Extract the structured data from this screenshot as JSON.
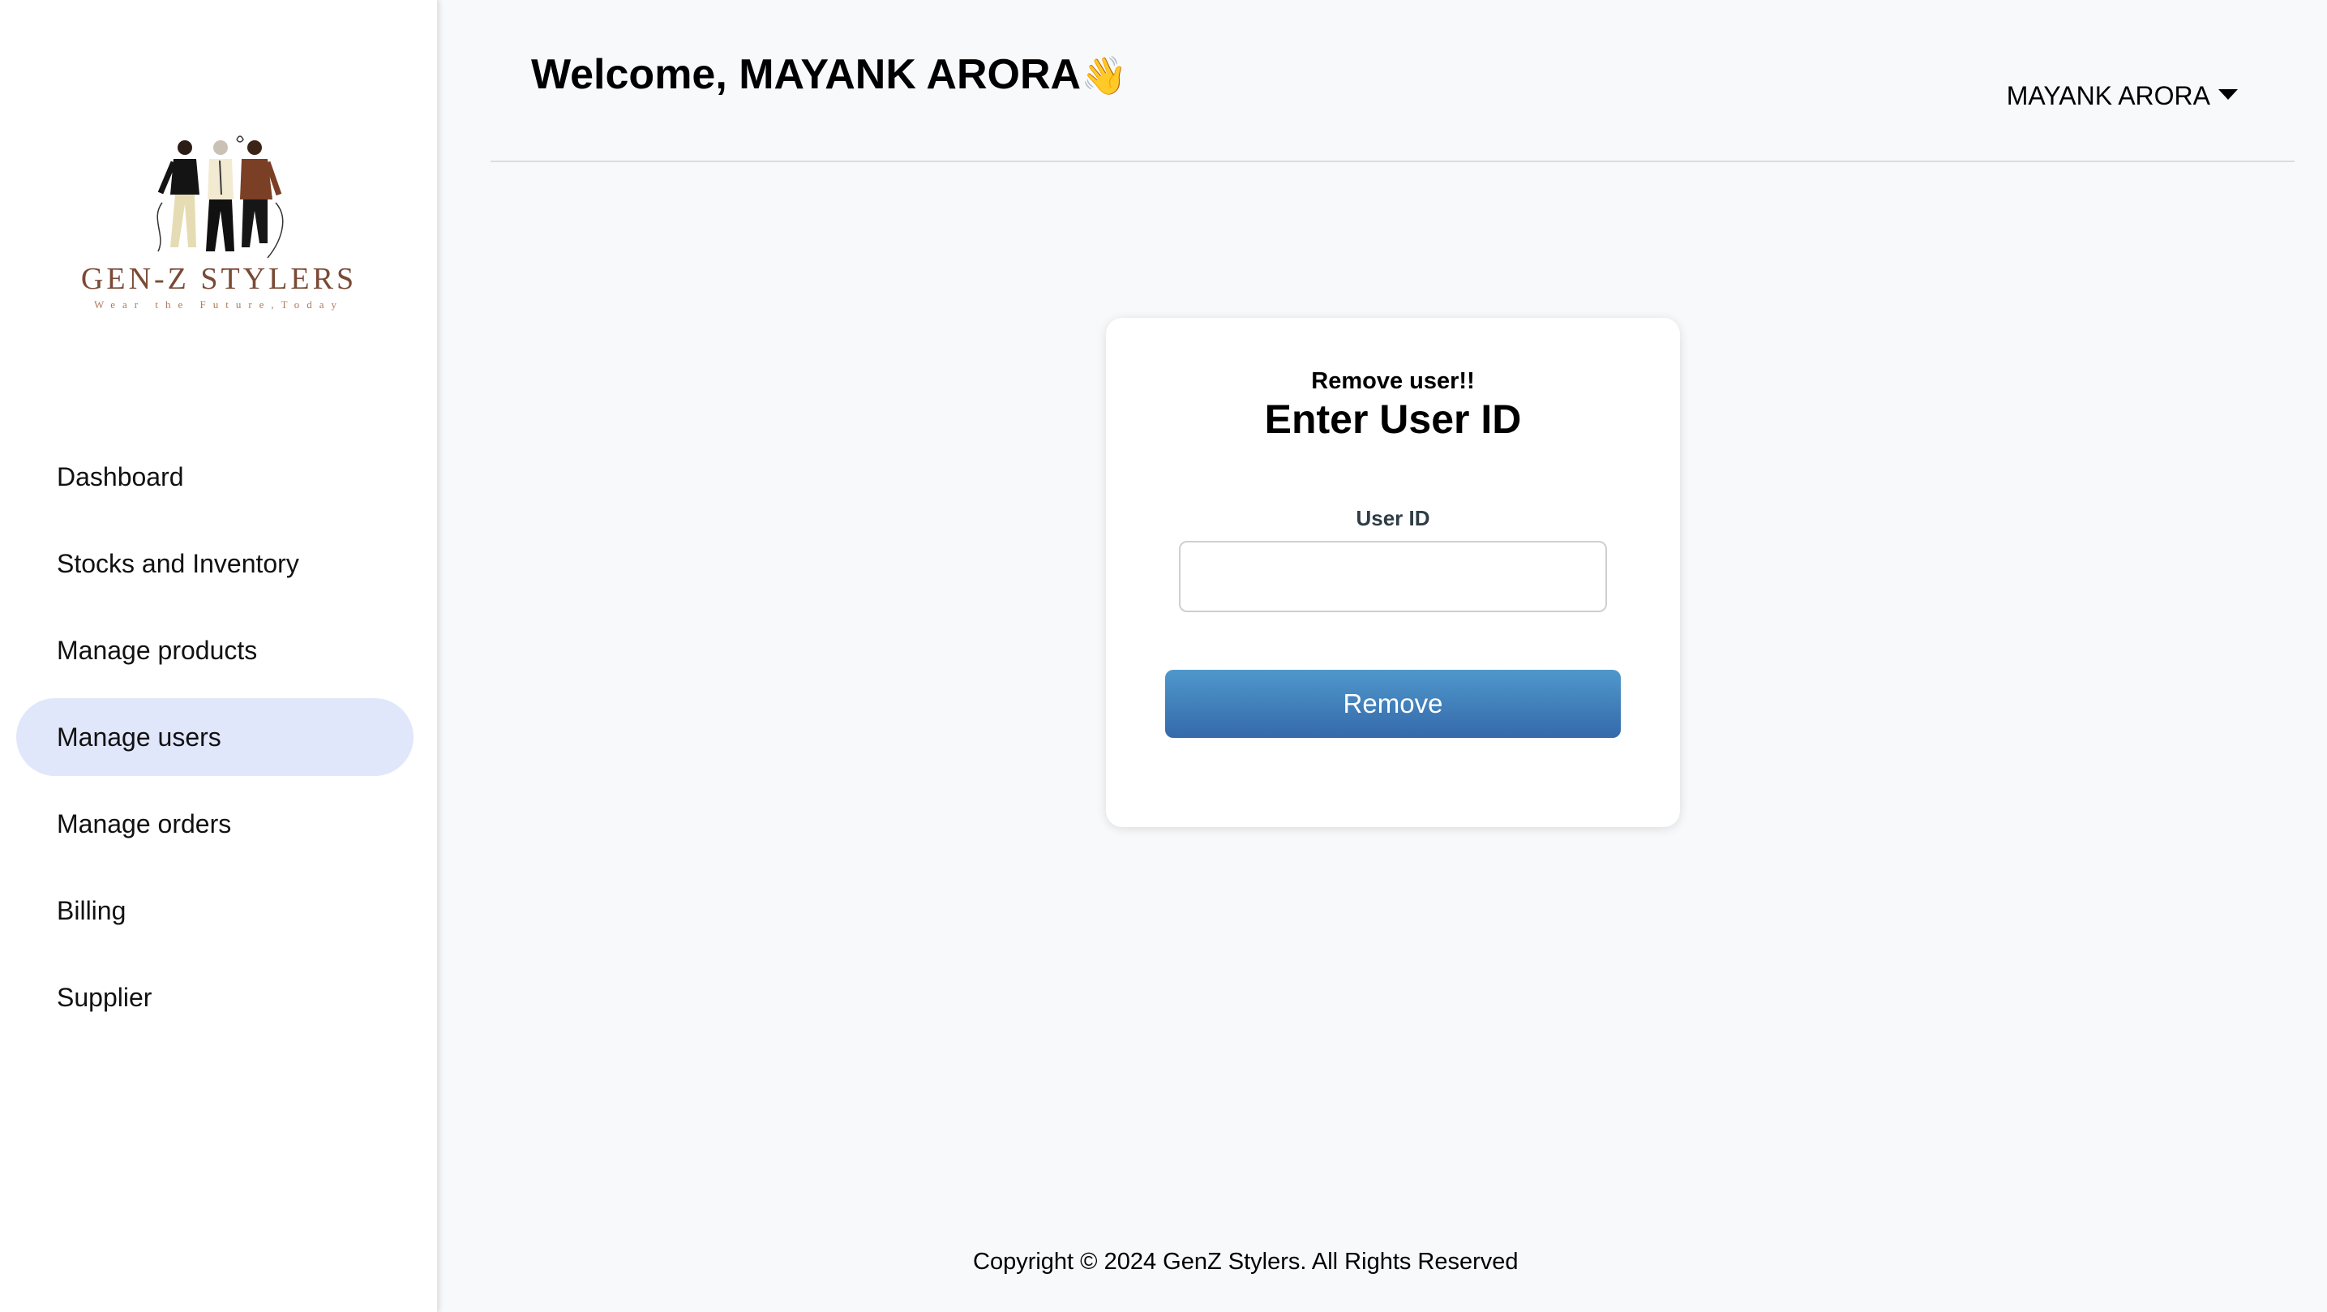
{
  "sidebar": {
    "logo": {
      "title": "GEN-Z STYLERS",
      "tagline": "Wear the Future,Today"
    },
    "items": [
      {
        "label": "Dashboard",
        "active": false
      },
      {
        "label": "Stocks and Inventory",
        "active": false
      },
      {
        "label": "Manage products",
        "active": false
      },
      {
        "label": "Manage users",
        "active": true
      },
      {
        "label": "Manage orders",
        "active": false
      },
      {
        "label": "Billing",
        "active": false
      },
      {
        "label": "Supplier",
        "active": false
      }
    ]
  },
  "header": {
    "welcome": "Welcome, MAYANK ARORA",
    "wave_emoji": "👋",
    "user_name": "MAYANK ARORA",
    "user_menu_icon": "caret-down-icon"
  },
  "card": {
    "subtitle": "Remove user!!",
    "title": "Enter User ID",
    "field_label": "User ID",
    "field_value": "",
    "field_placeholder": "",
    "button_label": "Remove"
  },
  "footer": {
    "text": "Copyright © 2024 GenZ Stylers. All Rights Reserved"
  },
  "colors": {
    "active_nav_bg": "#e1e7fb",
    "button_top": "#4f98cb",
    "button_bottom": "#3569ab",
    "logo_brown": "#7a4a35",
    "page_bg": "#f8f9fb"
  }
}
